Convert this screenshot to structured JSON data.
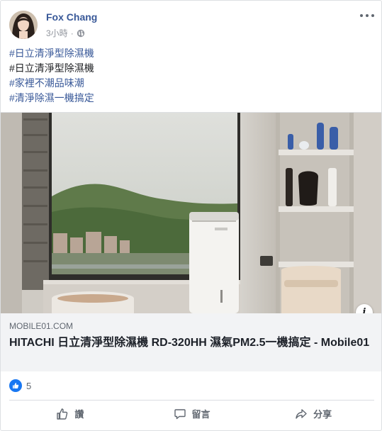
{
  "post": {
    "author": "Fox Chang",
    "time": "3小時",
    "meta_separator": "·",
    "privacy_icon": "globe-icon",
    "more_icon": "ellipsis-icon",
    "lines": [
      {
        "text": "#日立清淨型除濕機",
        "is_link": true
      },
      {
        "text": "#日立清淨型除濕機",
        "is_link": false
      },
      {
        "text": "#家裡不潮品味潮",
        "is_link": true
      },
      {
        "text": "#清淨除濕一機搞定",
        "is_link": true
      }
    ]
  },
  "link_preview": {
    "domain": "MOBILE01.COM",
    "title": "HITACHI 日立清淨型除濕機 RD-320HH 濕氣PM2.5一機搞定 - Mobile01",
    "info_label": "i"
  },
  "reactions": {
    "count": "5",
    "icon": "like-icon"
  },
  "actions": [
    {
      "label": "讚",
      "icon": "thumbs-up-icon"
    },
    {
      "label": "留言",
      "icon": "comment-icon"
    },
    {
      "label": "分享",
      "icon": "share-icon"
    }
  ],
  "colors": {
    "link": "#385898",
    "muted": "#606770",
    "like_blue": "#1877f2",
    "preview_bg": "#f2f3f5"
  }
}
